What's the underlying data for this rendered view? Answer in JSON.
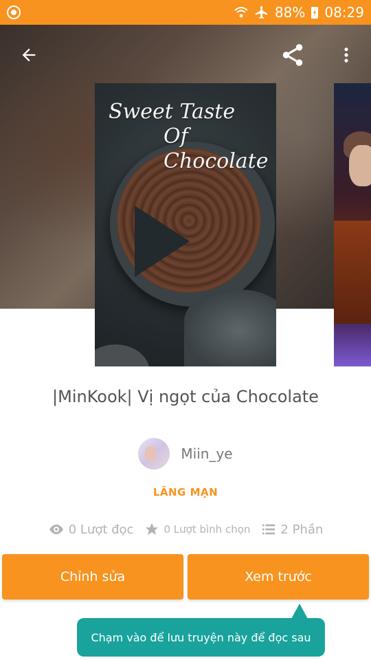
{
  "status_bar": {
    "battery": "88%",
    "time": "08:29"
  },
  "icons": {
    "back": "arrow-left-icon",
    "share": "share-icon",
    "more": "more-vertical-icon"
  },
  "cover": {
    "title_line1": "Sweet Taste",
    "title_line2": "Of Chocolate"
  },
  "story": {
    "title": "|MinKook| Vị ngọt của Chocolate",
    "author": "Miin_ye",
    "genre": "LÃNG MẠN"
  },
  "stats": {
    "reads": "0 Lượt đọc",
    "votes": "0 Lượt bình chọn",
    "parts": "2 Phần"
  },
  "buttons": {
    "edit": "Chỉnh sửa",
    "preview": "Xem trước"
  },
  "tooltip": {
    "text": "Chạm vào để lưu truyện này để đọc sau"
  },
  "colors": {
    "accent": "#f7931e",
    "tooltip": "#19a39c",
    "text_muted": "#b3b3b3"
  }
}
